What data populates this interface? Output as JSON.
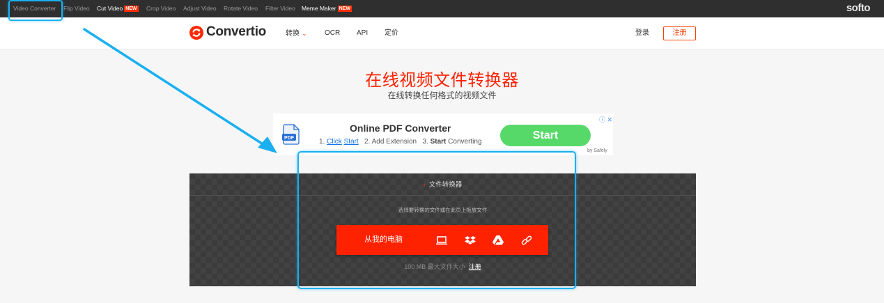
{
  "toolbar": {
    "items": [
      {
        "label": "Video Converter",
        "badge": ""
      },
      {
        "label": "Flip Video",
        "badge": ""
      },
      {
        "label": "Cut Video",
        "badge": "NEW"
      },
      {
        "label": "Crop Video",
        "badge": ""
      },
      {
        "label": "Adjust Video",
        "badge": ""
      },
      {
        "label": "Rotate Video",
        "badge": ""
      },
      {
        "label": "Filter Video",
        "badge": ""
      },
      {
        "label": "Meme Maker",
        "badge": "NEW"
      }
    ],
    "brand": "softo"
  },
  "header": {
    "logo_text": "Convertio",
    "nav": [
      {
        "label": "转换"
      },
      {
        "label": "OCR"
      },
      {
        "label": "API"
      },
      {
        "label": "定价"
      }
    ],
    "login_label": "登录",
    "signup_label": "注册"
  },
  "hero": {
    "title": "在线视频文件转换器",
    "subtitle": "在线转换任何格式的视频文件"
  },
  "ad": {
    "title": "Online PDF Converter",
    "step1_prefix": "1.",
    "step1_link1": "Click",
    "step1_link2": "Start",
    "step2": "2. Add Extension",
    "step3_prefix": "3.",
    "step3_bold": "Start",
    "step3_rest": "Converting",
    "start_label": "Start",
    "by_label": "by Safely",
    "icon_text": "PDF"
  },
  "converter": {
    "header_label": "文件转换器",
    "hint": "选择要转换的文件或在此页上拖放文件",
    "upload_label": "从我的电脑",
    "sources": [
      "computer-icon",
      "dropbox-icon",
      "google-drive-icon",
      "url-link-icon"
    ],
    "footer_size": "100 MB 最大文件大小",
    "footer_register": "注册"
  },
  "colors": {
    "accent": "#ff2200",
    "annotation": "#1ab0f0",
    "ad_button": "#57d96a"
  }
}
